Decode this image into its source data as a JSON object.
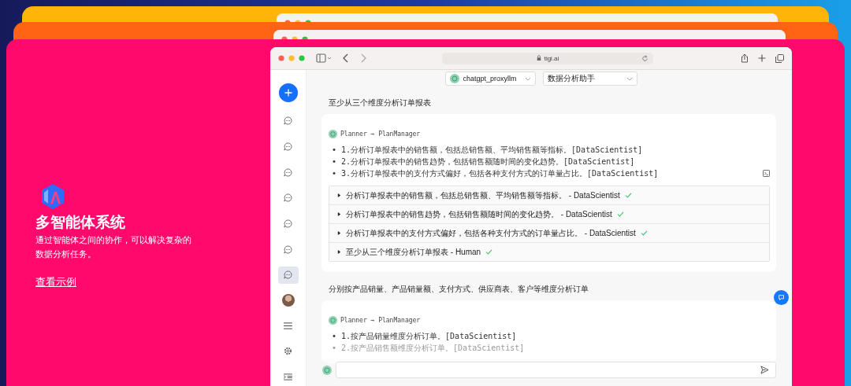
{
  "cards": [
    {
      "color": "#ffb40a"
    },
    {
      "color": "#ff6414"
    },
    {
      "color": "#ff0a6c"
    }
  ],
  "hero": {
    "title": "多智能体系统",
    "description": "通过智能体之间的协作，可以解决复杂的数据分析任务。",
    "link": "查看示例"
  },
  "browser": {
    "url": "tigi.ai"
  },
  "model_select": {
    "value": "chatgpt_proxyllm"
  },
  "app_select": {
    "value": "数据分析助手"
  },
  "sidebar": {
    "items": [
      {
        "kind": "new",
        "selected": false
      },
      {
        "kind": "chat",
        "selected": false
      },
      {
        "kind": "chat",
        "selected": false
      },
      {
        "kind": "chat",
        "selected": false
      },
      {
        "kind": "chat",
        "selected": false
      },
      {
        "kind": "chat",
        "selected": false
      },
      {
        "kind": "chat",
        "selected": false
      },
      {
        "kind": "chat",
        "selected": true
      },
      {
        "kind": "avatar",
        "selected": false
      },
      {
        "kind": "menu",
        "selected": false
      },
      {
        "kind": "settings",
        "selected": false
      },
      {
        "kind": "collapse",
        "selected": false
      }
    ]
  },
  "conversations": [
    {
      "question": "至少从三个维度分析订单报表",
      "sender": "Planner",
      "arrow": "→",
      "receiver": "PlanManager",
      "steps": [
        {
          "marker": "•",
          "text": "1.分析订单报表中的销售额，包括总销售额、平均销售额等指标。[DataScientist]",
          "faded": false
        },
        {
          "marker": "•",
          "text": "2.分析订单报表中的销售趋势，包括销售额随时间的变化趋势。[DataScientist]",
          "faded": false
        },
        {
          "marker": "•",
          "text": "3.分析订单报表中的支付方式偏好，包括各种支付方式的订单量占比。[DataScientist]",
          "faded": false
        }
      ],
      "tasks": [
        {
          "text": "分析订单报表中的销售额，包括总销售额、平均销售额等指标。 - DataScientist",
          "expanded": false,
          "done": true
        },
        {
          "text": "分析订单报表中的销售趋势，包括销售额随时间的变化趋势。 - DataScientist",
          "expanded": false,
          "done": true
        },
        {
          "text": "分析订单报表中的支付方式偏好，包括各种支付方式的订单量占比。 - DataScientist",
          "expanded": false,
          "done": true
        },
        {
          "text": "至少从三个维度分析订单报表 - Human",
          "expanded": false,
          "done": true
        }
      ]
    },
    {
      "question": "分别按产品销量、产品销量额、支付方式、供应商表、客户等维度分析订单",
      "sender": "Planner",
      "arrow": "→",
      "receiver": "PlanManager",
      "steps": [
        {
          "marker": "•",
          "text": "1.按产品销量维度分析订单。[DataScientist]",
          "faded": false
        },
        {
          "marker": "•",
          "text": "2.按产品销售额维度分析订单。[DataScientist]",
          "faded": true
        }
      ]
    }
  ]
}
